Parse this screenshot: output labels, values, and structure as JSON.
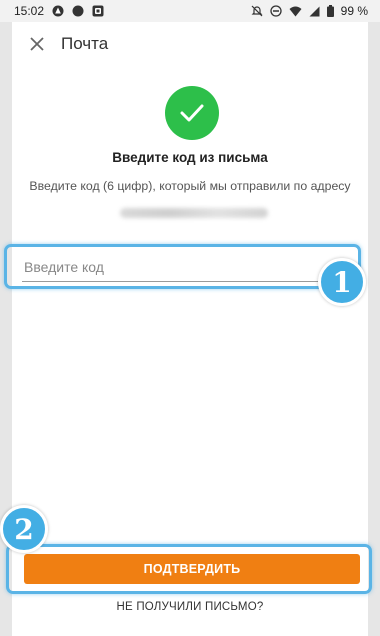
{
  "status_bar": {
    "time": "15:02",
    "left_icons": [
      "app-icon",
      "record-icon",
      "screenshot-icon"
    ],
    "right_icons": [
      "mute-icon",
      "dnd-icon",
      "wifi-icon",
      "signal-icon",
      "battery-icon"
    ],
    "battery_percent": "99 %"
  },
  "toolbar": {
    "close_icon": "close-icon",
    "title": "Почта"
  },
  "content": {
    "heading": "Введите код из письма",
    "subtext": "Введите код (6 цифр), который мы отправили по адресу",
    "code_input": {
      "placeholder": "Введите код",
      "value": ""
    },
    "confirm_label": "ПОДТВЕРДИТЬ",
    "resend_label": "НЕ ПОЛУЧИЛИ ПИСЬМО?"
  },
  "annotations": {
    "badge_1": "1",
    "badge_2": "2"
  },
  "colors": {
    "success": "#2dbf4a",
    "primary": "#f07f12",
    "highlight": "#5ab4e6",
    "badge": "#43aee4"
  }
}
